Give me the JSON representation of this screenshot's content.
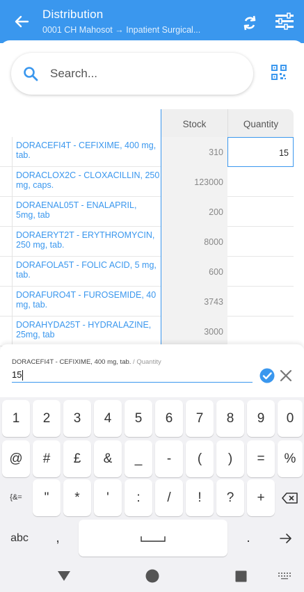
{
  "header": {
    "title": "Distribution",
    "subtitle_from": "0001 CH Mahosot",
    "subtitle_arrow": "→",
    "subtitle_to": "Inpatient Surgical...",
    "color": "#3a97ee"
  },
  "search": {
    "placeholder": "Search..."
  },
  "table": {
    "col_stock": "Stock",
    "col_quantity": "Quantity",
    "rows": [
      {
        "name_line1": "DORACEFI4T - CEFIXIME, 400 mg,",
        "name_line2": "tab.",
        "stock": "310",
        "quantity": "15"
      },
      {
        "name_line1": "DORACLOX2C - CLOXACILLIN, 250",
        "name_line2": "mg, caps.",
        "stock": "123000",
        "quantity": ""
      },
      {
        "name_line1": "DORAENAL05T - ENALAPRIL,",
        "name_line2": "5mg, tab",
        "stock": "200",
        "quantity": ""
      },
      {
        "name_line1": "DORAERYT2T - ERYTHROMYCIN,",
        "name_line2": "250 mg, tab.",
        "stock": "8000",
        "quantity": ""
      },
      {
        "name_line1": "DORAFOLA5T - FOLIC ACID, 5 mg,",
        "name_line2": "tab.",
        "stock": "600",
        "quantity": ""
      },
      {
        "name_line1": "DORAFURO4T - FUROSEMIDE, 40",
        "name_line2": "mg, tab.",
        "stock": "3743",
        "quantity": ""
      },
      {
        "name_line1": "DORAHYDA25T - HYDRALAZINE,",
        "name_line2": "25mg, tab",
        "stock": "3000",
        "quantity": ""
      }
    ]
  },
  "edit": {
    "item": "DORACEFI4T - CEFIXIME, 400 mg, tab.",
    "separator": "/",
    "field": "Quantity",
    "value": "15"
  },
  "keyboard": {
    "row1": [
      "1",
      "2",
      "3",
      "4",
      "5",
      "6",
      "7",
      "8",
      "9",
      "0"
    ],
    "row2": [
      "@",
      "#",
      "£",
      "&",
      "_",
      "-",
      "(",
      ")",
      "=",
      "%"
    ],
    "row3": [
      "{&=",
      "\"",
      "*",
      "'",
      ":",
      "/",
      "!",
      "?",
      "+"
    ],
    "abc": "abc",
    "comma": ",",
    "period": "."
  },
  "icons": [
    "back-arrow-icon",
    "sync-icon",
    "filter-icon",
    "search-icon",
    "qr-scan-icon",
    "check-circle-icon",
    "close-icon",
    "backspace-icon",
    "enter-arrow-icon",
    "space-bar-icon",
    "nav-back-icon",
    "nav-home-icon",
    "nav-recents-icon",
    "keyboard-switch-icon"
  ]
}
